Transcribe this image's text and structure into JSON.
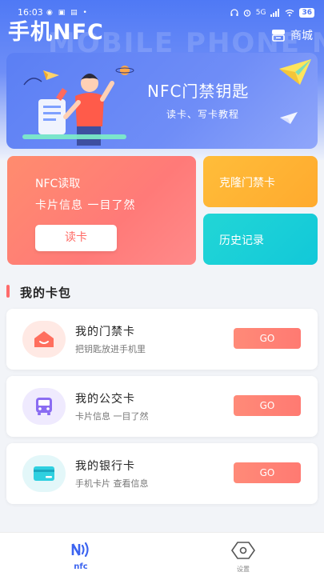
{
  "status_bar": {
    "time": "16:03",
    "left_icons": "◉ ▣ ▤ •",
    "right_text": "5G",
    "battery": "36"
  },
  "header": {
    "title": "手机NFC",
    "watermark": "MOBILE PHONE NFC",
    "store_label": "商城"
  },
  "banner": {
    "title": "NFC门禁钥匙",
    "subtitle": "读卡、写卡教程"
  },
  "read_card": {
    "title": "NFC读取",
    "subtitle": "卡片信息 一目了然",
    "button_label": "读卡"
  },
  "clone_card": {
    "label": "克隆门禁卡"
  },
  "history_card": {
    "label": "历史记录"
  },
  "wallet": {
    "title": "我的卡包",
    "cards": [
      {
        "title": "我的门禁卡",
        "subtitle": "把钥匙放进手机里",
        "go_label": "GO",
        "icon": "home-icon",
        "icon_bg": "#ffe9e4"
      },
      {
        "title": "我的公交卡",
        "subtitle": "卡片信息 一目了然",
        "go_label": "GO",
        "icon": "bus-icon",
        "icon_bg": "#efeafe"
      },
      {
        "title": "我的银行卡",
        "subtitle": "手机卡片 查看信息",
        "go_label": "GO",
        "icon": "bank-card-icon",
        "icon_bg": "#e3f7f9"
      }
    ]
  },
  "bottom_nav": {
    "items": [
      {
        "label": "nfc",
        "icon": "nfc-icon",
        "active": true
      },
      {
        "label": "设置",
        "icon": "settings-hexagon-icon",
        "active": false
      }
    ]
  },
  "colors": {
    "primary_blue": "#4f79f5",
    "coral": "#ff7a72",
    "orange": "#ffaa2e",
    "cyan": "#12c8d9",
    "active_nav": "#3c64f0"
  }
}
